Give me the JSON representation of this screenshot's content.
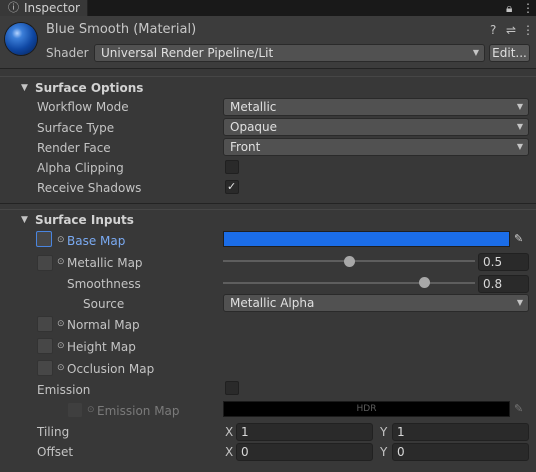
{
  "tab": {
    "label": "Inspector",
    "icon": "info-icon"
  },
  "header": {
    "title": "Blue Smooth (Material)",
    "shader_label": "Shader",
    "shader_value": "Universal Render Pipeline/Lit",
    "edit_label": "Edit..."
  },
  "surface_options": {
    "title": "Surface Options",
    "workflow_mode": {
      "label": "Workflow Mode",
      "value": "Metallic"
    },
    "surface_type": {
      "label": "Surface Type",
      "value": "Opaque"
    },
    "render_face": {
      "label": "Render Face",
      "value": "Front"
    },
    "alpha_clipping": {
      "label": "Alpha Clipping",
      "checked": false
    },
    "receive_shadows": {
      "label": "Receive Shadows",
      "checked": true
    }
  },
  "surface_inputs": {
    "title": "Surface Inputs",
    "base_map": {
      "label": "Base Map",
      "color": "#1b6de8"
    },
    "metallic_map": {
      "label": "Metallic Map",
      "value": "0.5",
      "fraction": 0.5
    },
    "smoothness": {
      "label": "Smoothness",
      "value": "0.8",
      "fraction": 0.8
    },
    "source": {
      "label": "Source",
      "value": "Metallic Alpha"
    },
    "normal_map": {
      "label": "Normal Map"
    },
    "height_map": {
      "label": "Height Map"
    },
    "occlusion_map": {
      "label": "Occlusion Map"
    },
    "emission": {
      "label": "Emission",
      "checked": false
    },
    "emission_map": {
      "label": "Emission Map",
      "hdr_label": "HDR",
      "color": "#000000"
    },
    "tiling": {
      "label": "Tiling",
      "x_label": "X",
      "x": "1",
      "y_label": "Y",
      "y": "1"
    },
    "offset": {
      "label": "Offset",
      "x_label": "X",
      "x": "0",
      "y_label": "Y",
      "y": "0"
    }
  },
  "colors": {
    "panel_bg": "#383838",
    "accent_blue": "#7aaaf2",
    "base_color": "#1b6de8"
  }
}
